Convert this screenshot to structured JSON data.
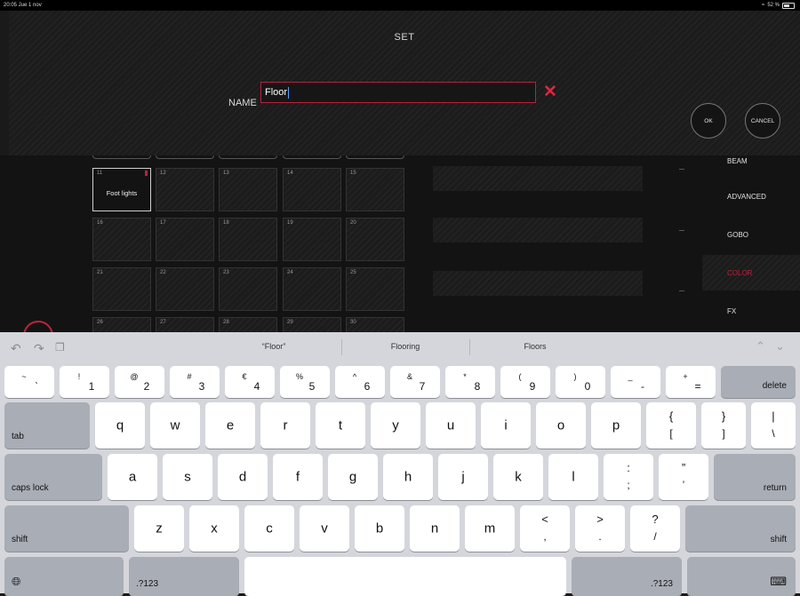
{
  "status_bar": {
    "time": "20:05  Jue 1 nov",
    "battery": "52 %"
  },
  "dialog": {
    "title": "SET",
    "name_label": "NAME",
    "name_value": "Floor",
    "clear_icon": "close-x-icon",
    "ok_label": "OK",
    "cancel_label": "CANCEL"
  },
  "grid": {
    "cells": [
      {
        "num": "11",
        "label": "Foot lights"
      },
      {
        "num": "12",
        "label": ""
      },
      {
        "num": "13",
        "label": ""
      },
      {
        "num": "14",
        "label": ""
      },
      {
        "num": "15",
        "label": ""
      },
      {
        "num": "16",
        "label": ""
      },
      {
        "num": "17",
        "label": ""
      },
      {
        "num": "18",
        "label": ""
      },
      {
        "num": "19",
        "label": ""
      },
      {
        "num": "20",
        "label": ""
      },
      {
        "num": "21",
        "label": ""
      },
      {
        "num": "22",
        "label": ""
      },
      {
        "num": "23",
        "label": ""
      },
      {
        "num": "24",
        "label": ""
      },
      {
        "num": "25",
        "label": ""
      },
      {
        "num": "26",
        "label": ""
      },
      {
        "num": "27",
        "label": ""
      },
      {
        "num": "28",
        "label": ""
      },
      {
        "num": "29",
        "label": ""
      },
      {
        "num": "30",
        "label": ""
      }
    ]
  },
  "side_menu": {
    "items": [
      {
        "label": "BEAM"
      },
      {
        "label": "ADVANCED"
      },
      {
        "label": "GOBO"
      },
      {
        "label": "COLOR"
      },
      {
        "label": "FX"
      }
    ],
    "accent_color": "#c2213b"
  },
  "suggestions": {
    "items": [
      "“Floor”",
      "Flooring",
      "Floors"
    ]
  },
  "keyboard": {
    "number_row": [
      {
        "top": "~",
        "bot": "`"
      },
      {
        "top": "!",
        "bot": "1"
      },
      {
        "top": "@",
        "bot": "2"
      },
      {
        "top": "#",
        "bot": "3"
      },
      {
        "top": "€",
        "bot": "4"
      },
      {
        "top": "%",
        "bot": "5"
      },
      {
        "top": "^",
        "bot": "6"
      },
      {
        "top": "&",
        "bot": "7"
      },
      {
        "top": "*",
        "bot": "8"
      },
      {
        "top": "(",
        "bot": "9"
      },
      {
        "top": ")",
        "bot": "0"
      },
      {
        "top": "_",
        "bot": "-"
      },
      {
        "top": "+",
        "bot": "="
      }
    ],
    "delete_label": "delete",
    "tab_label": "tab",
    "row_q": [
      "q",
      "w",
      "e",
      "r",
      "t",
      "y",
      "u",
      "i",
      "o",
      "p"
    ],
    "row_q_extra": [
      {
        "top": "{",
        "bot": "["
      },
      {
        "top": "}",
        "bot": "]"
      },
      {
        "top": "|",
        "bot": "\\"
      }
    ],
    "caps_label": "caps lock",
    "row_a": [
      "a",
      "s",
      "d",
      "f",
      "g",
      "h",
      "j",
      "k",
      "l"
    ],
    "row_a_extra": [
      {
        "top": ":",
        "bot": ";"
      },
      {
        "top": "”",
        "bot": "’"
      }
    ],
    "return_label": "return",
    "shift_label": "shift",
    "row_z": [
      "z",
      "x",
      "c",
      "v",
      "b",
      "n",
      "m"
    ],
    "row_z_extra": [
      {
        "top": "<",
        "bot": ","
      },
      {
        "top": ">",
        "bot": "."
      },
      {
        "top": "?",
        "bot": "/"
      }
    ],
    "numbers_label": ".?123"
  }
}
